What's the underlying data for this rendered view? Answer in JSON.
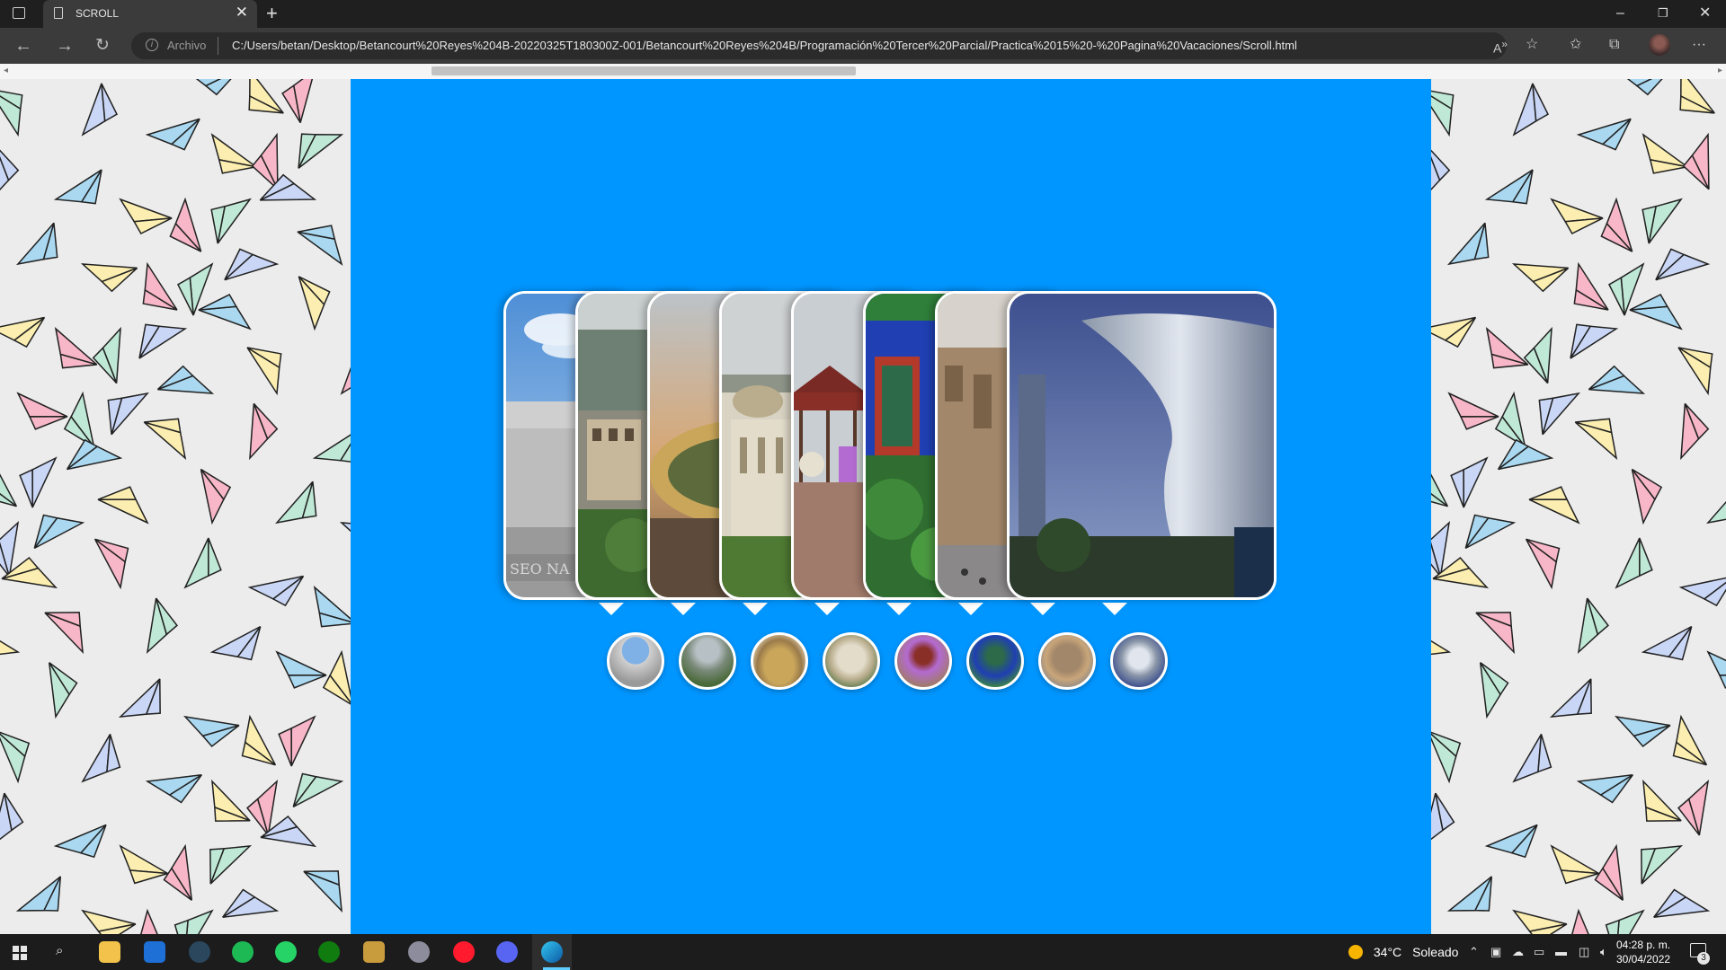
{
  "browser": {
    "tab_title": "SCROLL",
    "address_scheme": "Archivo",
    "address_url": "C:/Users/betan/Desktop/Betancourt%20Reyes%204B-20220325T180300Z-001/Betancourt%20Reyes%204B/Programación%20Tercer%20Parcial/Practica%2015%20-%20Pagina%20Vacaciones/Scroll.html"
  },
  "gallery": {
    "cards": [
      {
        "name": "museo-nacional-antropologia"
      },
      {
        "name": "castillo-chapultepec"
      },
      {
        "name": "estadio-azteca"
      },
      {
        "name": "bellas-artes"
      },
      {
        "name": "kiosco-plaza"
      },
      {
        "name": "casa-azul"
      },
      {
        "name": "catedral-metropolitana"
      },
      {
        "name": "museo-soumaya"
      }
    ],
    "partial_text": "SEO NA",
    "active_index": 7,
    "background_color": "#0096ff"
  },
  "taskbar": {
    "weather_temp": "34°C",
    "weather_text": "Soleado",
    "time": "04:28 p. m.",
    "date": "30/04/2022",
    "notifications": "3"
  }
}
